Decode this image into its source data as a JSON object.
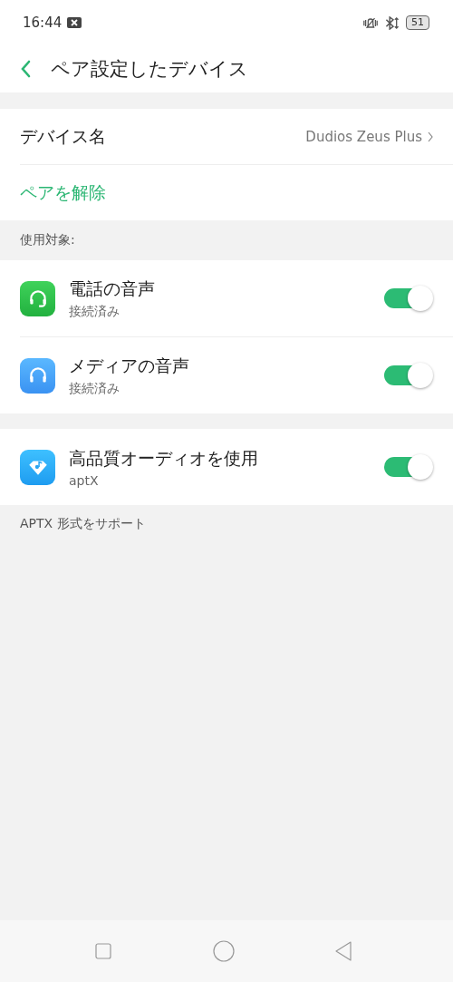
{
  "status_bar": {
    "time": "16:44",
    "battery": "51"
  },
  "header": {
    "title": "ペア設定したデバイス"
  },
  "device": {
    "label": "デバイス名",
    "value": "Dudios Zeus Plus",
    "unpair": "ペアを解除"
  },
  "section_label": "使用対象:",
  "profiles": [
    {
      "kind": "phone",
      "title": "電話の音声",
      "subtitle": "接続済み",
      "on": true
    },
    {
      "kind": "media",
      "title": "メディアの音声",
      "subtitle": "接続済み",
      "on": true
    }
  ],
  "hd_audio": {
    "kind": "aptx",
    "title": "高品質オーディオを使用",
    "subtitle": "aptX",
    "on": true
  },
  "footnote": "APTX 形式をサポート"
}
